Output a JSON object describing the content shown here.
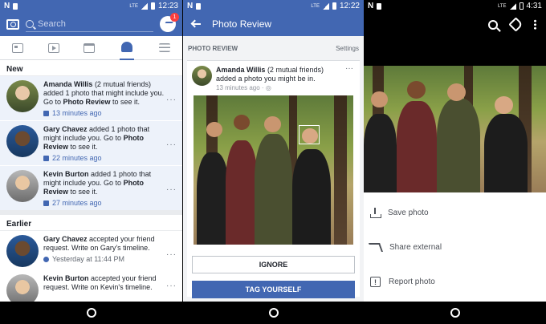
{
  "screen1": {
    "status": {
      "time": "12:23"
    },
    "search": {
      "placeholder": "Search"
    },
    "messenger_badge": "1",
    "sections": {
      "new": "New",
      "earlier": "Earlier"
    },
    "notifications_new": [
      {
        "name": "Amanda Willis",
        "suffix": " (2 mutual friends)",
        "text": " added 1 photo that might include you. Go to ",
        "bold2": "Photo Review",
        "tail": " to see it.",
        "time": "13 minutes ago"
      },
      {
        "name": "Gary Chavez",
        "suffix": "",
        "text": " added 1 photo that might include you. Go to ",
        "bold2": "Photo Review",
        "tail": " to see it.",
        "time": "22 minutes ago"
      },
      {
        "name": "Kevin Burton",
        "suffix": "",
        "text": " added 1 photo that might include you. Go to ",
        "bold2": "Photo Review",
        "tail": " to see it.",
        "time": "27 minutes ago"
      }
    ],
    "notifications_earlier": [
      {
        "name": "Gary Chavez",
        "text": " accepted your friend request. Write on Gary's timeline.",
        "time": "Yesterday at 11:44 PM"
      },
      {
        "name": "Kevin Burton",
        "text": " accepted your friend request. Write on Kevin's timeline.",
        "time": ""
      }
    ]
  },
  "screen2": {
    "status": {
      "time": "12:22"
    },
    "title": "Photo Review",
    "section": "PHOTO REVIEW",
    "settings": "Settings",
    "post": {
      "name": "Amanda Willis",
      "suffix": " (2 mutual friends)",
      "action": "added a photo you might be in.",
      "time": "13 minutes ago ·"
    },
    "ignore_label": "IGNORE",
    "tag_label": "TAG YOURSELF"
  },
  "screen3": {
    "status": {
      "time": "4:31"
    },
    "menu": [
      "Save photo",
      "Share external",
      "Report photo"
    ]
  }
}
